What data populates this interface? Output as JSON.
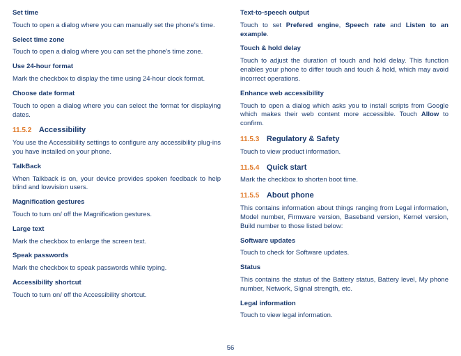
{
  "left": {
    "settime_h": "Set time",
    "settime_b": "Touch to open a dialog where you can manually set the phone's time.",
    "tz_h": "Select time zone",
    "tz_b": "Touch to open a dialog where you can set the phone's time zone.",
    "fmt24_h": "Use 24-hour format",
    "fmt24_b": "Mark the checkbox to display the time using 24-hour clock format.",
    "datefmt_h": "Choose date format",
    "datefmt_b": "Touch to open a dialog where you can select the format for displaying dates.",
    "s1152_num": "11.5.2",
    "s1152_title": "Accessibility",
    "s1152_b": "You use the Accessibility settings to configure any accessibility plug-ins you have installed on your phone.",
    "tb_h": "TalkBack",
    "tb_b": "When Talkback is on, your device provides spoken feedback to help blind and lowvision users.",
    "mag_h": "Magnification gestures",
    "mag_b": "Touch to turn on/ off the Magnification gestures.",
    "lg_h": "Large text",
    "lg_b": "Mark the checkbox to enlarge the screen text.",
    "sp_h": "Speak passwords",
    "sp_b": "Mark the checkbox to speak passwords while typing.",
    "as_h": "Accessibility shortcut",
    "as_b": "Touch to turn on/ off the Accessibility shortcut."
  },
  "right": {
    "tts_h": "Text-to-speech output",
    "tts_pre": "Touch to set ",
    "tts_b1": "Prefered engine",
    "tts_c1": ", ",
    "tts_b2": "Speech rate",
    "tts_c2": " and ",
    "tts_b3": "Listen to an example",
    "tts_c3": ".",
    "th_h": "Touch & hold delay",
    "th_b": "Touch to adjust the duration of touch and hold delay. This function enables your phone to differ touch and touch & hold, which may avoid incorrect operations.",
    "ew_h": "Enhance web accessibility",
    "ew_pre": "Touch to open a dialog which asks you to install scripts from Google which makes their web content more accessible. Touch ",
    "ew_b": "Allow",
    "ew_post": " to confirm.",
    "s1153_num": "11.5.3",
    "s1153_title": "Regulatory & Safety",
    "s1153_b": "Touch to view product information.",
    "s1154_num": "11.5.4",
    "s1154_title": "Quick start",
    "s1154_b": "Mark the checkbox to shorten boot time.",
    "s1155_num": "11.5.5",
    "s1155_title": "About phone",
    "s1155_b": "This contains information about things ranging from Legal information, Model number, Firmware version, Baseband version, Kernel version, Build number to those listed below:",
    "su_h": "Software updates",
    "su_b": "Touch to check for Software updates.",
    "st_h": "Status",
    "st_b": "This contains the status of the Battery status, Battery level, My phone number, Network, Signal strength, etc.",
    "li_h": "Legal information",
    "li_b": "Touch to view legal information."
  },
  "page": "56"
}
